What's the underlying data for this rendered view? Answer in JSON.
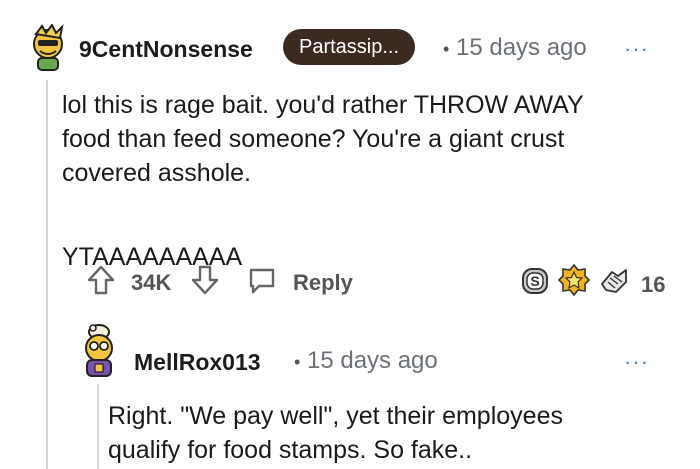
{
  "comment": {
    "username": "9CentNonsense",
    "flair": "Partassip...",
    "separator": "•",
    "timestamp": "15 days ago",
    "more": "···",
    "body_line1": "lol this is rage bait. you'd rather THROW AWAY",
    "body_line2": "food than feed someone? You're a giant crust",
    "body_line3": "covered asshole.",
    "body_line4": "YTAAAAAAAAA",
    "votes": "34K",
    "reply_label": "Reply",
    "award_count": "16"
  },
  "reply": {
    "username": "MellRox013",
    "separator": "•",
    "timestamp": "15 days ago",
    "more": "···",
    "body_line1": "Right. \"We pay well\", yet their employees",
    "body_line2": "qualify for food stamps. So fake.."
  },
  "icons": [
    "avatar-icon",
    "upvote-icon",
    "downvote-icon",
    "comment-icon",
    "silver-award-icon",
    "gold-award-icon",
    "wholesome-award-icon"
  ]
}
